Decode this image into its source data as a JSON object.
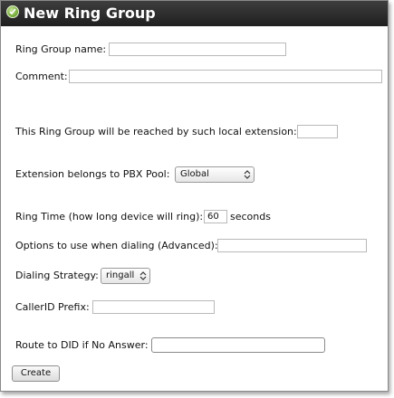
{
  "dialog": {
    "title": "New Ring Group",
    "icon": "green-circle-icon"
  },
  "form": {
    "name_label": "Ring Group name:",
    "name_value": "",
    "comment_label": "Comment:",
    "comment_value": "",
    "extension_label": "This Ring Group will be reached by such local extension:",
    "extension_value": "",
    "pool_label": "Extension belongs to PBX Pool:",
    "pool_value": "Global",
    "ring_time_label": "Ring Time (how long device will ring):",
    "ring_time_value": "60",
    "ring_time_unit": "seconds",
    "options_label": "Options to use when dialing (Advanced):",
    "options_value": "",
    "strategy_label": "Dialing Strategy:",
    "strategy_value": "ringall",
    "callerid_label": "CallerID Prefix:",
    "callerid_value": "",
    "did_label": "Route to DID if No Answer:",
    "did_value": "",
    "create_label": "Create"
  },
  "colors": {
    "titlebar": "#2a2a2a",
    "icon": "#6ea634"
  }
}
